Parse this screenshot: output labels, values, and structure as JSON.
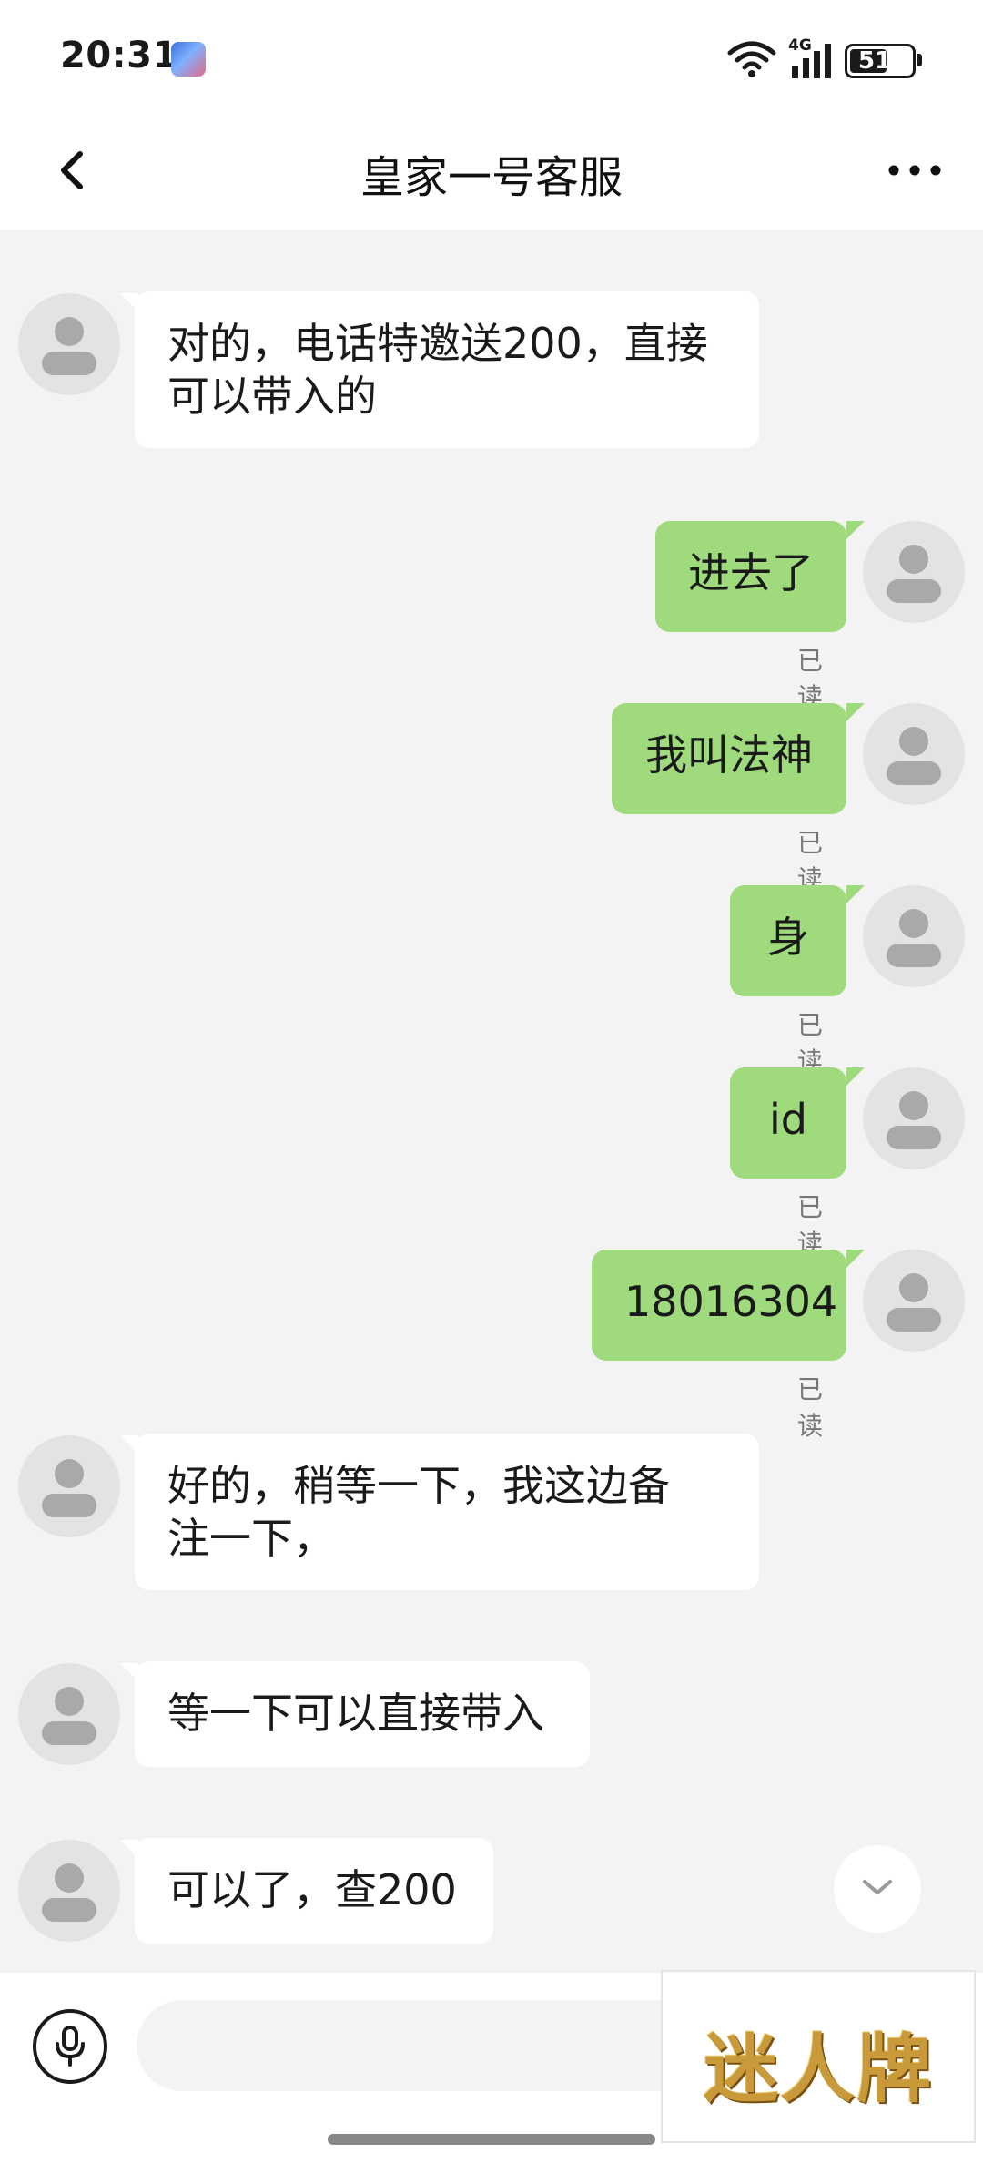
{
  "status_bar": {
    "time": "20:31",
    "network": "4G",
    "battery": "51"
  },
  "header": {
    "title": "皇家一号客服"
  },
  "messages": [
    {
      "side": "in",
      "text": "对的，电话特邀送200，直接\n可以带入的"
    },
    {
      "side": "out",
      "text": "进去了",
      "status": "已读"
    },
    {
      "side": "out",
      "text": "我叫法神",
      "status": "已读"
    },
    {
      "side": "out",
      "text": "身",
      "status": "已读"
    },
    {
      "side": "out",
      "text": "id",
      "status": "已读"
    },
    {
      "side": "out",
      "text": "18016304",
      "status": "已读"
    },
    {
      "side": "in",
      "text": "好的，稍等一下，我这边备\n注一下，"
    },
    {
      "side": "in",
      "text": "等一下可以直接带入"
    },
    {
      "side": "in",
      "text": "可以了，查200"
    }
  ],
  "input": {
    "value": "",
    "placeholder": ""
  },
  "watermark": {
    "text": "迷人牌"
  },
  "colors": {
    "outgoing_bubble": "#9fdb7c",
    "incoming_bubble": "#ffffff",
    "chat_background": "#f3f3f3"
  }
}
